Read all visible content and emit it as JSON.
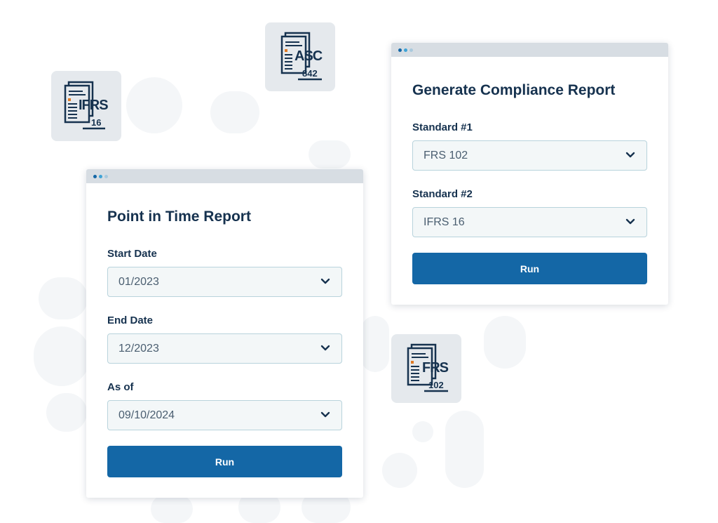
{
  "icons": [
    {
      "name": "ifrs-16-document-icon",
      "line1": "IFRS",
      "line2": "16"
    },
    {
      "name": "asc-842-document-icon",
      "line1": "ASC",
      "line2": "842"
    },
    {
      "name": "frs-102-document-icon",
      "line1": "FRS",
      "line2": "102"
    }
  ],
  "point_in_time": {
    "title": "Point in Time Report",
    "start_date": {
      "label": "Start Date",
      "value": "01/2023"
    },
    "end_date": {
      "label": "End Date",
      "value": "12/2023"
    },
    "as_of": {
      "label": "As of",
      "value": "09/10/2024"
    },
    "run_label": "Run"
  },
  "compliance": {
    "title": "Generate Compliance Report",
    "standard1": {
      "label": "Standard #1",
      "value": "FRS 102"
    },
    "standard2": {
      "label": "Standard #2",
      "value": "IFRS 16"
    },
    "run_label": "Run"
  },
  "colors": {
    "accent": "#1467a6",
    "text": "#16324f",
    "window_bar": "#d7dde3",
    "dot_1": "#1467a6",
    "dot_2": "#3fa3d6",
    "dot_3": "#a9c9dd"
  }
}
